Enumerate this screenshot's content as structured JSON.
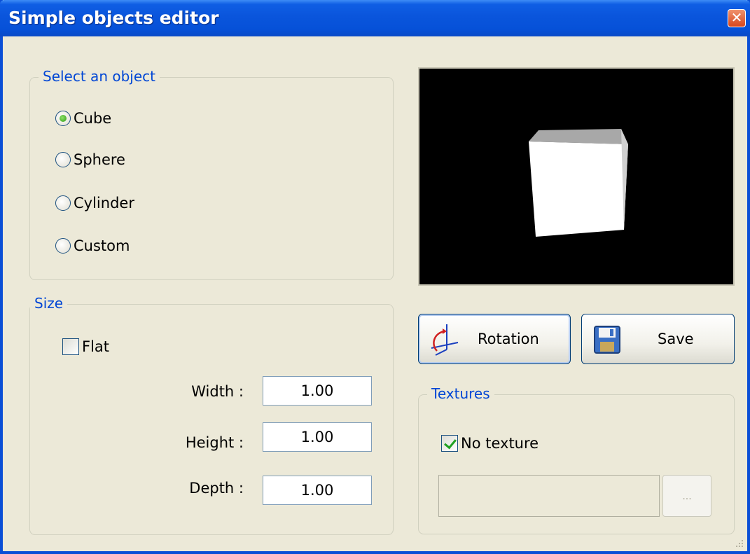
{
  "window": {
    "title": "Simple objects editor",
    "close_label": "✕"
  },
  "object_group": {
    "title": "Select an object",
    "options": [
      {
        "label": "Cube",
        "checked": true
      },
      {
        "label": "Sphere",
        "checked": false
      },
      {
        "label": "Cylinder",
        "checked": false
      },
      {
        "label": "Custom",
        "checked": false
      }
    ]
  },
  "size_group": {
    "title": "Size",
    "flat_label": "Flat",
    "flat_checked": false,
    "width_label": "Width :",
    "width_value": "1.00",
    "height_label": "Height :",
    "height_value": "1.00",
    "depth_label": "Depth :",
    "depth_value": "1.00"
  },
  "buttons": {
    "rotation_label": "Rotation",
    "save_label": "Save"
  },
  "textures_group": {
    "title": "Textures",
    "no_texture_label": "No texture",
    "no_texture_checked": true,
    "path_value": "",
    "browse_label": "..."
  },
  "colors": {
    "accent": "#0046d5",
    "title_bar": "#0a55dc",
    "preview_bg": "#000000"
  }
}
